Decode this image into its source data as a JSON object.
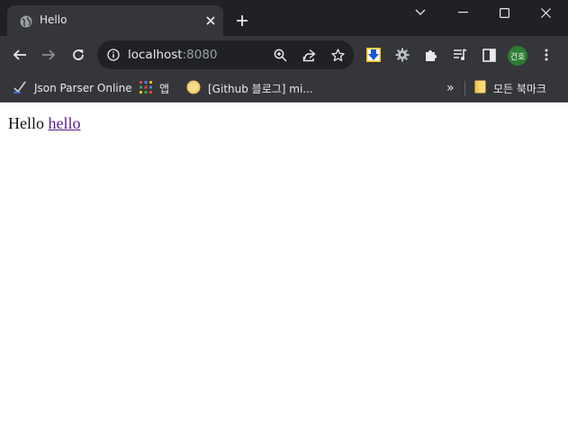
{
  "window": {
    "tab_title": "Hello",
    "controls": [
      "collapse",
      "minimize",
      "maximize",
      "close"
    ]
  },
  "toolbar": {
    "url_host": "localhost",
    "url_port": ":8080",
    "profile_initials": "건호"
  },
  "bookmarks": {
    "items": [
      {
        "label": "Json Parser Online",
        "icon": "json-parser-icon"
      },
      {
        "label": "앱",
        "icon": "apps-grid-icon"
      },
      {
        "label": "[Github 블로그] mi...",
        "icon": "github-blog-icon"
      }
    ],
    "overflow_label": "»",
    "all_bookmarks_label": "모든 북마크"
  },
  "page": {
    "text": "Hello",
    "link_text": "hello"
  },
  "colors": {
    "titlebar": "#202124",
    "toolbar": "#35363a",
    "omnibox": "#202124",
    "link_visited": "#551a8b",
    "avatar": "#2e7d32"
  }
}
